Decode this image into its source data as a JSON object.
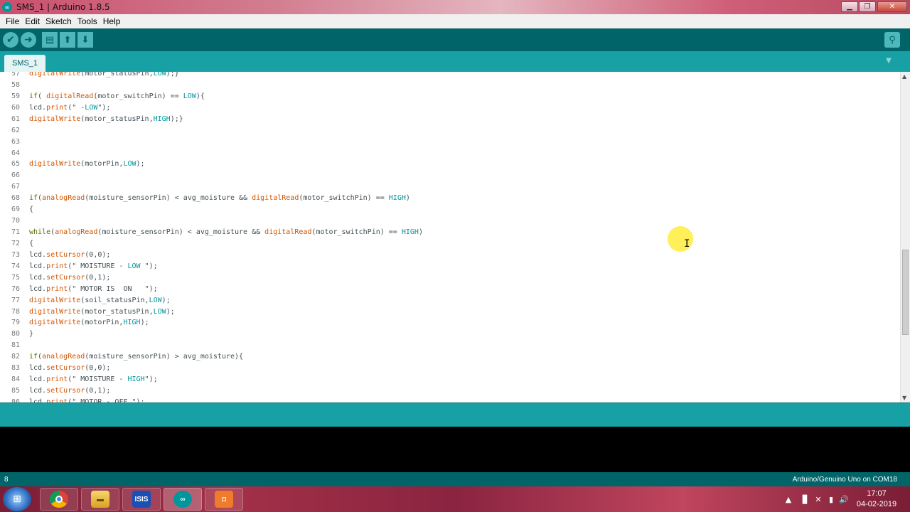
{
  "window": {
    "title": "SMS_1 | Arduino 1.8.5",
    "app_icon": "arduino-icon"
  },
  "window_controls": {
    "minimize": "▁",
    "maximize": "❐",
    "close": "✕"
  },
  "menu": [
    "File",
    "Edit",
    "Sketch",
    "Tools",
    "Help"
  ],
  "toolbar": {
    "verify_icon": "check-icon",
    "verify_glyph": "✔",
    "upload_icon": "arrow-right-icon",
    "upload_glyph": "➜",
    "new_icon": "new-file-icon",
    "new_glyph": "▤",
    "open_icon": "arrow-up-icon",
    "open_glyph": "⬆",
    "save_icon": "arrow-down-icon",
    "save_glyph": "⬇",
    "serial_monitor_icon": "magnifier-icon",
    "serial_monitor_glyph": "⚲"
  },
  "tabs": {
    "active": "SMS_1",
    "menu_glyph": "▼"
  },
  "code": {
    "lines": [
      {
        "n": "57",
        "t": "digitalWrite(motor_statusPin,LOW);}"
      },
      {
        "n": "58",
        "t": ""
      },
      {
        "n": "59",
        "t": "if( digitalRead(motor_switchPin) == LOW){"
      },
      {
        "n": "60",
        "t": "lcd.print(\" -LOW\");"
      },
      {
        "n": "61",
        "t": "digitalWrite(motor_statusPin,HIGH);}"
      },
      {
        "n": "62",
        "t": ""
      },
      {
        "n": "63",
        "t": ""
      },
      {
        "n": "64",
        "t": ""
      },
      {
        "n": "65",
        "t": "digitalWrite(motorPin,LOW);"
      },
      {
        "n": "66",
        "t": ""
      },
      {
        "n": "67",
        "t": ""
      },
      {
        "n": "68",
        "t": "if(analogRead(moisture_sensorPin) < avg_moisture && digitalRead(motor_switchPin) == HIGH)"
      },
      {
        "n": "69",
        "t": "{"
      },
      {
        "n": "70",
        "t": ""
      },
      {
        "n": "71",
        "t": "while(analogRead(moisture_sensorPin) < avg_moisture && digitalRead(motor_switchPin) == HIGH)"
      },
      {
        "n": "72",
        "t": "{"
      },
      {
        "n": "73",
        "t": "lcd.setCursor(0,0);"
      },
      {
        "n": "74",
        "t": "lcd.print(\" MOISTURE - LOW \");"
      },
      {
        "n": "75",
        "t": "lcd.setCursor(0,1);"
      },
      {
        "n": "76",
        "t": "lcd.print(\" MOTOR IS  ON   \");"
      },
      {
        "n": "77",
        "t": "digitalWrite(soil_statusPin,LOW);"
      },
      {
        "n": "78",
        "t": "digitalWrite(motor_statusPin,LOW);"
      },
      {
        "n": "79",
        "t": "digitalWrite(motorPin,HIGH);"
      },
      {
        "n": "80",
        "t": "}"
      },
      {
        "n": "81",
        "t": ""
      },
      {
        "n": "82",
        "t": "if(analogRead(moisture_sensorPin) > avg_moisture){"
      },
      {
        "n": "83",
        "t": "lcd.setCursor(0,0);"
      },
      {
        "n": "84",
        "t": "lcd.print(\" MOISTURE - HIGH\");"
      },
      {
        "n": "85",
        "t": "lcd.setCursor(0,1);"
      },
      {
        "n": "86",
        "t": "lcd.print(\" MOTOR - OFF \");"
      }
    ]
  },
  "syntax": {
    "functions": [
      "digitalWrite",
      "digitalRead",
      "analogRead",
      "print",
      "setCursor"
    ],
    "keywords": [
      "if",
      "while"
    ],
    "constants": [
      "LOW",
      "HIGH"
    ]
  },
  "colors": {
    "toolbar_bg": "#006468",
    "tabbar_bg": "#17a1a5",
    "function_color": "#d35400",
    "keyword_color": "#5e6d03",
    "constant_color": "#00979c"
  },
  "status": {
    "line": "8",
    "board": "Arduino/Genuino Uno on COM18"
  },
  "taskbar": {
    "start_glyph": "⊞",
    "apps": [
      {
        "name": "chrome",
        "label": ""
      },
      {
        "name": "file-explorer",
        "label": ""
      },
      {
        "name": "isis",
        "label": "ISIS"
      },
      {
        "name": "arduino",
        "label": "∞"
      },
      {
        "name": "orange-app",
        "label": "◘"
      }
    ],
    "tray_glyphs": [
      "▲",
      "▊",
      "✕",
      "▮",
      "🔊"
    ],
    "time": "17:07",
    "date": "04-02-2019"
  }
}
